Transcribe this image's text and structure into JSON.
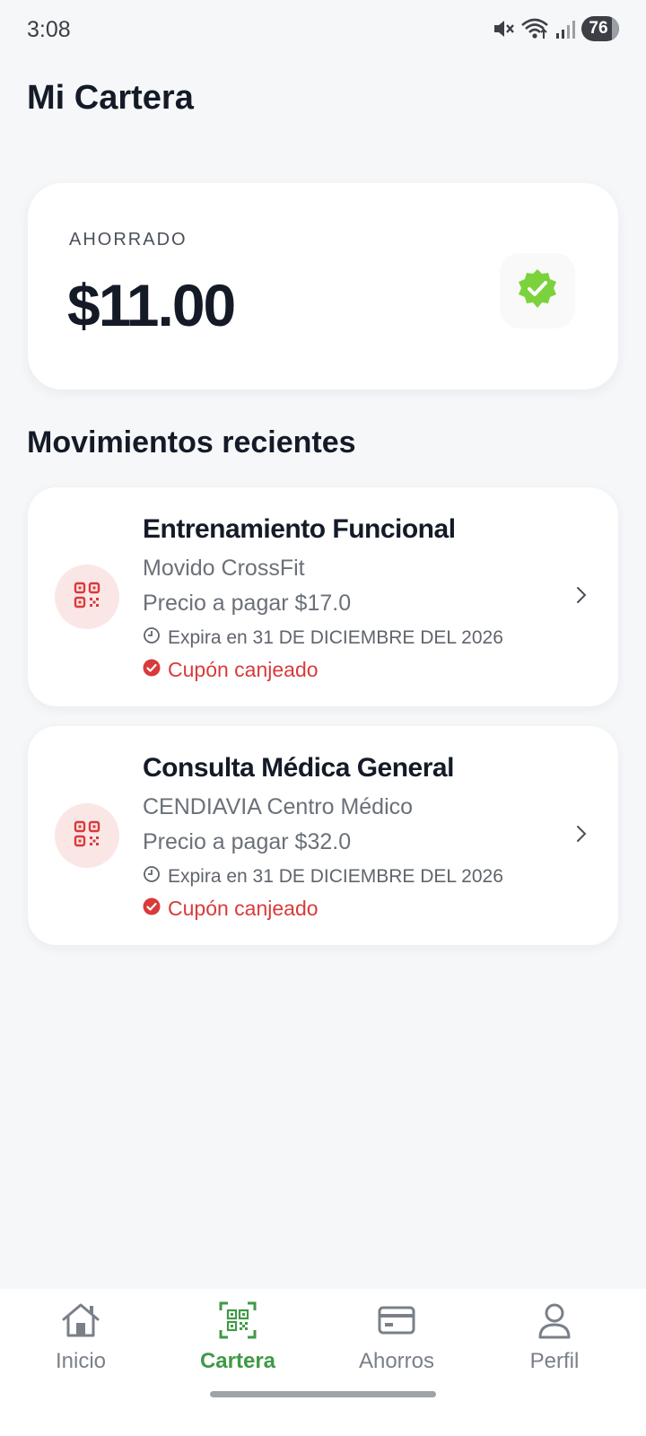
{
  "status_bar": {
    "time": "3:08",
    "battery": "76"
  },
  "page": {
    "title": "Mi Cartera"
  },
  "savings": {
    "label": "AHORRADO",
    "amount": "$11.00"
  },
  "section": {
    "title": "Movimientos recientes"
  },
  "movements": [
    {
      "title": "Entrenamiento Funcional",
      "provider": "Movido CrossFit",
      "price": "Precio a pagar $17.0",
      "expiry": "Expira en 31 DE DICIEMBRE DEL 2026",
      "status": "Cupón canjeado"
    },
    {
      "title": "Consulta Médica General",
      "provider": "CENDIAVIA Centro Médico",
      "price": "Precio a pagar $32.0",
      "expiry": "Expira en 31 DE DICIEMBRE DEL 2026",
      "status": "Cupón canjeado"
    }
  ],
  "nav": {
    "items": [
      {
        "label": "Inicio",
        "icon": "home-icon"
      },
      {
        "label": "Cartera",
        "icon": "qr-wallet-icon",
        "active": true
      },
      {
        "label": "Ahorros",
        "icon": "card-icon"
      },
      {
        "label": "Perfil",
        "icon": "user-icon"
      }
    ]
  },
  "colors": {
    "accent_green": "#3f9a46",
    "verified_green": "#7bd23c",
    "redeemed_red": "#d93a3a",
    "background": "#f5f7f9"
  }
}
